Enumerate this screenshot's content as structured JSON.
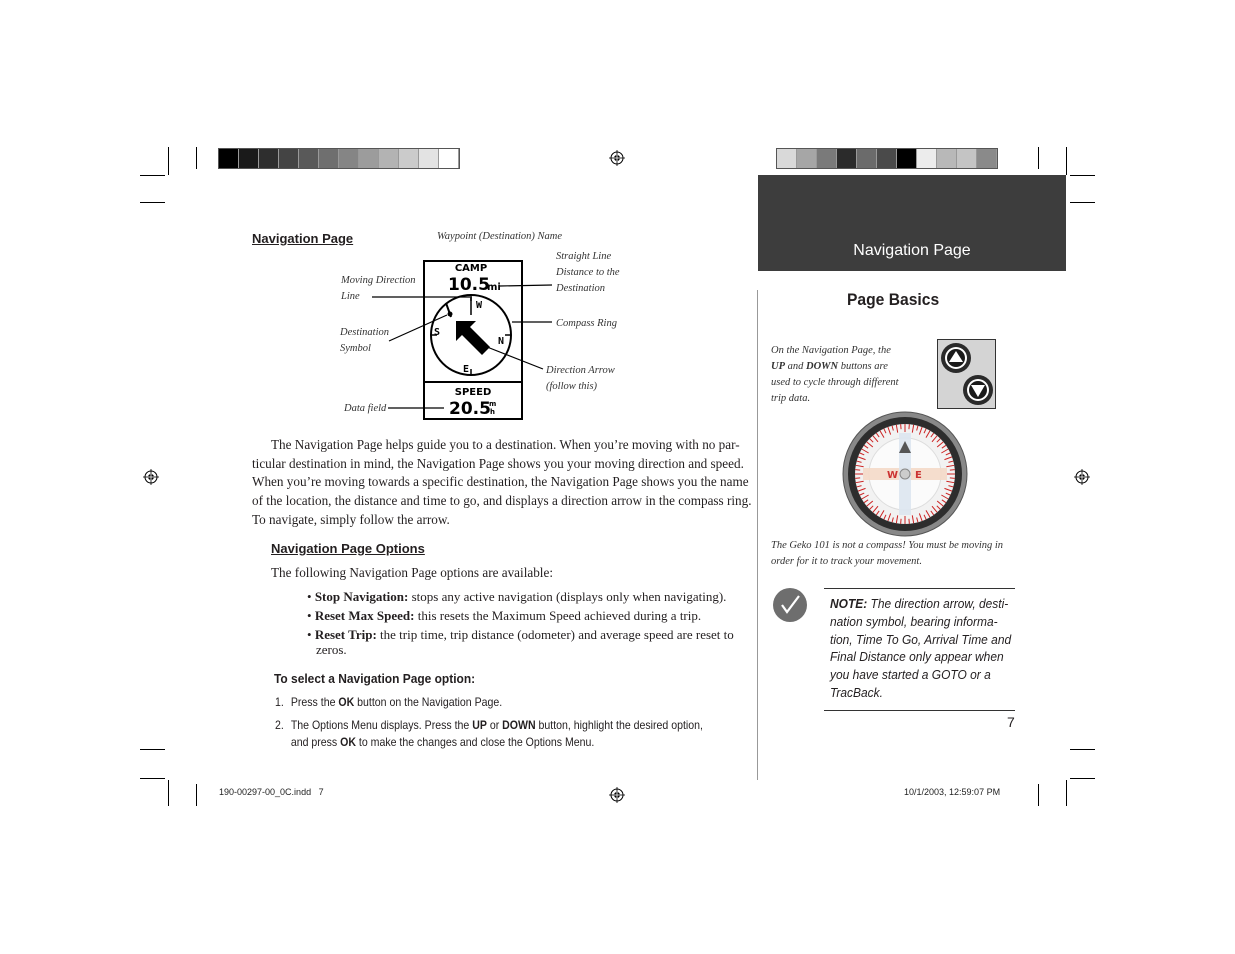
{
  "left_page": {
    "section_title": "Navigation Page",
    "figure": {
      "callouts": {
        "waypoint_name": "Waypoint (Destination) Name",
        "straight_line_distance": [
          "Straight Line",
          "Distance to the",
          "Destination"
        ],
        "moving_direction_line": [
          "Moving Direction",
          "Line"
        ],
        "compass_ring": "Compass Ring",
        "destination_symbol": [
          "Destination",
          "Symbol"
        ],
        "direction_arrow": [
          "Direction Arrow",
          "(follow this)"
        ],
        "data_field": "Data field"
      },
      "screen": {
        "waypoint": "CAMP",
        "distance_value": "10.5",
        "distance_unit": "mi",
        "compass_letters": {
          "n": "N",
          "s": "S",
          "e": "E",
          "w": "W"
        },
        "data_label": "SPEED",
        "data_value": "20.5",
        "data_unit_top": "m",
        "data_unit_bottom": "h"
      }
    },
    "intro_paragraph": "The Navigation Page helps guide you to a destination. When you’re moving with no particular destination in mind, the Navigation Page shows you your moving direction and speed. When you’re moving towards a specific destination, the Navigation Page shows you the name of the location, the distance and time to go, and displays a direction arrow in the compass ring. To navigate, simply follow the arrow.",
    "intro_lines": [
      "The Navigation Page helps guide you to a destination. When you’re moving with no par-",
      "ticular destination in mind, the Navigation Page shows you your moving direction and speed.",
      "When you’re moving towards a specific destination, the Navigation Page shows you the name",
      "of the location, the distance and time to go, and displays a direction arrow in the compass ring.",
      "To navigate, simply follow the arrow."
    ],
    "options_title": "Navigation Page Options",
    "options_intro": "The following Navigation Page options are available:",
    "options": [
      {
        "label": "Stop Navigation:",
        "text": " stops any active navigation (displays only when navigating)."
      },
      {
        "label": "Reset Max Speed:",
        "text": " this resets the Maximum Speed achieved during a trip."
      },
      {
        "label": "Reset Trip:",
        "text": " the trip time, trip distance (odometer) and average speed are reset to",
        "text2": "zeros."
      }
    ],
    "procedure_title": "To select a Navigation Page option:",
    "steps": [
      {
        "num": "1.",
        "parts": [
          "Press the ",
          "OK",
          " button on the Navigation Page."
        ]
      },
      {
        "num": "2.",
        "parts": [
          "The Options Menu displays. Press the ",
          "UP",
          " or ",
          "DOWN",
          " button, highlight the desired option,"
        ],
        "line2": [
          "and press ",
          "OK",
          " to make the changes and close the Options Menu."
        ]
      }
    ]
  },
  "right_page": {
    "header_title": "Navigation Page",
    "subtitle": "Page Basics",
    "buttons_caption": {
      "line1": "On the Navigation Page, the",
      "up": "UP",
      "and": " and ",
      "down": "DOWN",
      "line2_rest": " buttons are",
      "line3": "used to cycle through different",
      "line4": "trip data."
    },
    "compass_labels": {
      "w": "W",
      "e": "E"
    },
    "compass_caption": [
      "The Geko 101 is not a compass! You must be moving in",
      "order for it to track your movement."
    ],
    "note": {
      "label": "NOTE:",
      "lines": [
        " The direction arrow, desti-",
        "nation symbol, bearing informa-",
        "tion, Time To Go, Arrival Time and",
        "Final Distance only appear when",
        "you have started a GOTO or a",
        "TracBack."
      ]
    },
    "page_number": "7"
  },
  "footer": {
    "file": "190-00297-00_0C.indd   7",
    "timestamp": "10/1/2003, 12:59:07 PM"
  },
  "color_bars": {
    "left": [
      "#000000",
      "#1a1a1a",
      "#2e2e2e",
      "#444444",
      "#595959",
      "#6f6f6f",
      "#858585",
      "#9c9c9c",
      "#b3b3b3",
      "#cbcbcb",
      "#e3e3e3",
      "#ffffff"
    ],
    "right": [
      "#d9d9d9",
      "#a6a6a6",
      "#7a7a7a",
      "#2b2b2b",
      "#6b6b6b",
      "#4a4a4a",
      "#000000",
      "#ececec",
      "#b8b8b8",
      "#c4c4c4",
      "#8a8a8a"
    ]
  }
}
